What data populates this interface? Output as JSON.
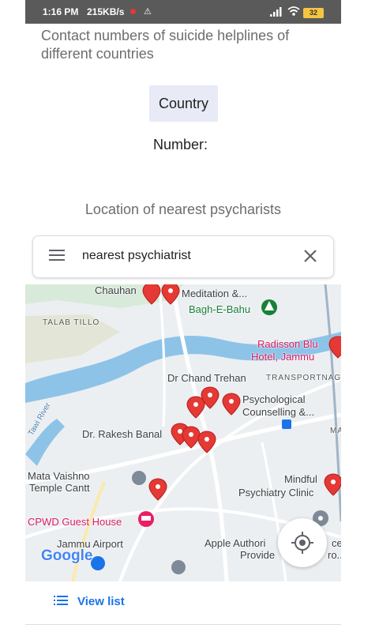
{
  "status_bar": {
    "time": "1:16 PM",
    "speed": "215KB/s",
    "battery": "32"
  },
  "heading": "Contact numbers of suicide helplines of different countries",
  "country_button": "Country",
  "number_label": "Number:",
  "location_title": "Location of nearest psycharists",
  "search": {
    "query": "nearest psychiatrist"
  },
  "map": {
    "labels": {
      "chauhan": "Chauhan",
      "meditation": "Meditation &...",
      "bagh": "Bagh-E-Bahu",
      "talab": "TALAB TILLO",
      "radisson": "Radisson Blu",
      "hotel": "Hotel, Jammu",
      "chand": "Dr Chand Trehan",
      "transport": "TRANSPORTNAGA",
      "psychological": "Psychological",
      "counselling": "Counselling &...",
      "rakesh": "Dr. Rakesh Banal",
      "ma": "MA",
      "river": "Tawi River",
      "vaishno1": "Mata Vaishno",
      "vaishno2": "Temple Cantt",
      "mindful1": "Mindful",
      "mindful2": "Psychiatry Clinic",
      "cpwd": "CPWD Guest House",
      "airport": "Jammu Airport",
      "apple": "Apple Authori",
      "apple2": "ce",
      "provide": "Provide",
      "provide2": "ro...",
      "google": "Google"
    }
  },
  "bottom": {
    "view_list": "View list"
  },
  "colors": {
    "accent": "#1a73e8",
    "pin": "#e53935",
    "river": "#8ec3e8",
    "road": "#ffffff",
    "park": "#cfe8d0"
  }
}
